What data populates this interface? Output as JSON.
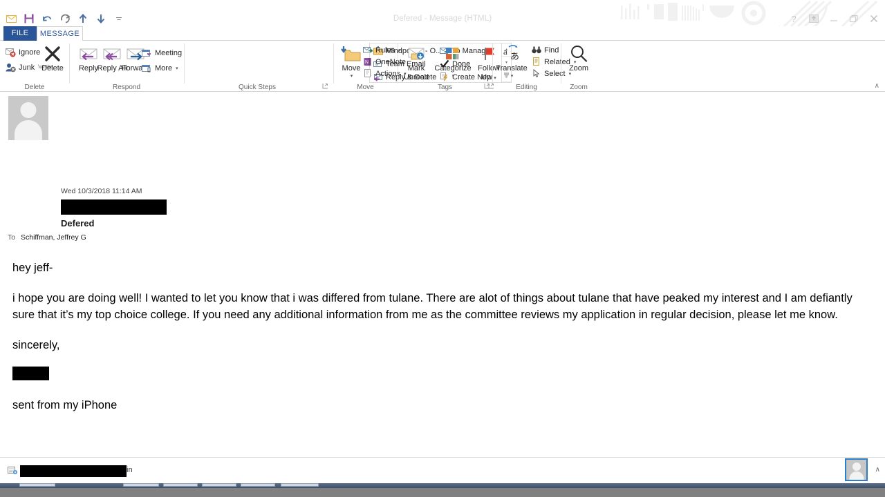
{
  "window": {
    "title": "Defered  - Message (HTML)",
    "quick_access": [
      {
        "name": "envelope-icon",
        "glyph": "✉"
      },
      {
        "name": "save-icon",
        "glyph": "▣"
      },
      {
        "name": "undo-icon",
        "glyph": "↶"
      },
      {
        "name": "redo-icon",
        "glyph": "↻"
      },
      {
        "name": "previous-item-icon",
        "glyph": "↑"
      },
      {
        "name": "next-item-icon",
        "glyph": "↓"
      },
      {
        "name": "customize-qat-icon",
        "glyph": " "
      }
    ],
    "controls": [
      {
        "name": "help-button",
        "glyph": "?"
      },
      {
        "name": "ribbon-display-options-button",
        "glyph": "□"
      },
      {
        "name": "minimize-button",
        "glyph": "—"
      },
      {
        "name": "restore-button",
        "glyph": "❐"
      },
      {
        "name": "close-button",
        "glyph": "✕"
      }
    ]
  },
  "tabs": [
    {
      "label": "FILE",
      "active": false
    },
    {
      "label": "MESSAGE",
      "active": true
    }
  ],
  "ribbon": {
    "collapse_label": "∧",
    "groups": [
      {
        "name": "delete",
        "label": "Delete",
        "small_buttons": [
          {
            "label": "Ignore",
            "icon": "ignore-icon",
            "caret": false
          },
          {
            "label": "Junk",
            "icon": "junk-icon",
            "caret": true
          }
        ],
        "big_buttons": [
          {
            "label": "Delete",
            "icon": "delete-x-icon"
          }
        ]
      },
      {
        "name": "respond",
        "label": "Respond",
        "big_buttons": [
          {
            "label": "Reply",
            "icon": "reply-icon"
          },
          {
            "label": "Reply All",
            "icon": "reply-all-icon"
          },
          {
            "label": "Forward",
            "icon": "forward-icon"
          }
        ],
        "small_buttons": [
          {
            "label": "Meeting",
            "icon": "meeting-icon",
            "caret": false
          },
          {
            "label": "More",
            "icon": "more-respond-icon",
            "caret": true
          }
        ]
      },
      {
        "name": "quick-steps",
        "label": "Quick Steps",
        "items": [
          {
            "label": "Mindpower - O...",
            "icon": "move-to-folder-icon"
          },
          {
            "label": "To Manager",
            "icon": "to-manager-icon"
          },
          {
            "label": "Team Email",
            "icon": "team-email-icon"
          },
          {
            "label": "Done",
            "icon": "done-check-icon"
          },
          {
            "label": "Reply & Delete",
            "icon": "reply-delete-icon"
          },
          {
            "label": "Create New",
            "icon": "create-new-icon"
          }
        ],
        "scroll_buttons": [
          {
            "name": "quick-steps-scroll-up",
            "glyph": "▴"
          },
          {
            "name": "quick-steps-scroll-down",
            "glyph": "▾"
          },
          {
            "name": "quick-steps-more",
            "glyph": "☰"
          }
        ],
        "dialog_launcher": "⤵"
      },
      {
        "name": "move",
        "label": "Move",
        "big_buttons": [
          {
            "label": "Move",
            "icon": "move-folder-icon",
            "caret": true
          }
        ],
        "small_buttons": [
          {
            "label": "Rules",
            "icon": "rules-icon",
            "caret": true
          },
          {
            "label": "OneNote",
            "icon": "onenote-icon",
            "caret": false
          },
          {
            "label": "Actions",
            "icon": "actions-icon",
            "caret": true
          }
        ]
      },
      {
        "name": "tags",
        "label": "Tags",
        "big_buttons": [
          {
            "label": "Mark Unread",
            "icon": "mark-unread-icon"
          },
          {
            "label": "Categorize",
            "icon": "categorize-icon",
            "caret": true
          },
          {
            "label": "Follow Up",
            "icon": "follow-up-flag-icon",
            "caret": true
          }
        ],
        "dialog_launcher": "⤵"
      },
      {
        "name": "editing",
        "label": "Editing",
        "big_buttons": [
          {
            "label": "Translate",
            "icon": "translate-icon",
            "caret": true
          }
        ],
        "small_buttons": [
          {
            "label": "Find",
            "icon": "find-binoculars-icon",
            "caret": false
          },
          {
            "label": "Related",
            "icon": "related-icon",
            "caret": true
          },
          {
            "label": "Select",
            "icon": "select-cursor-icon",
            "caret": true
          }
        ]
      },
      {
        "name": "zoom",
        "label": "Zoom",
        "big_buttons": [
          {
            "label": "Zoom",
            "icon": "zoom-magnifier-icon"
          }
        ]
      }
    ]
  },
  "message": {
    "date": "Wed 10/3/2018 11:14 AM",
    "sender_redacted": true,
    "subject": "Defered",
    "to_label": "To",
    "to_value": "Schiffman, Jeffrey G",
    "body": {
      "greeting": "hey jeff-",
      "paragraph": "i hope you are doing well! I wanted to let you know that i was differed from tulane. There are alot of things about tulane that have peaked my interest and I am defiantly sure that it’s my top choice college. If you need any additional information from me as the committee reviews my application in regular decision, please let me know.",
      "closing": "sincerely,",
      "name_redacted": true,
      "signature": "sent from my iPhone"
    }
  },
  "statusbar": {
    "text_after_redaction": "in",
    "redacted": true,
    "chevron": "∧"
  }
}
